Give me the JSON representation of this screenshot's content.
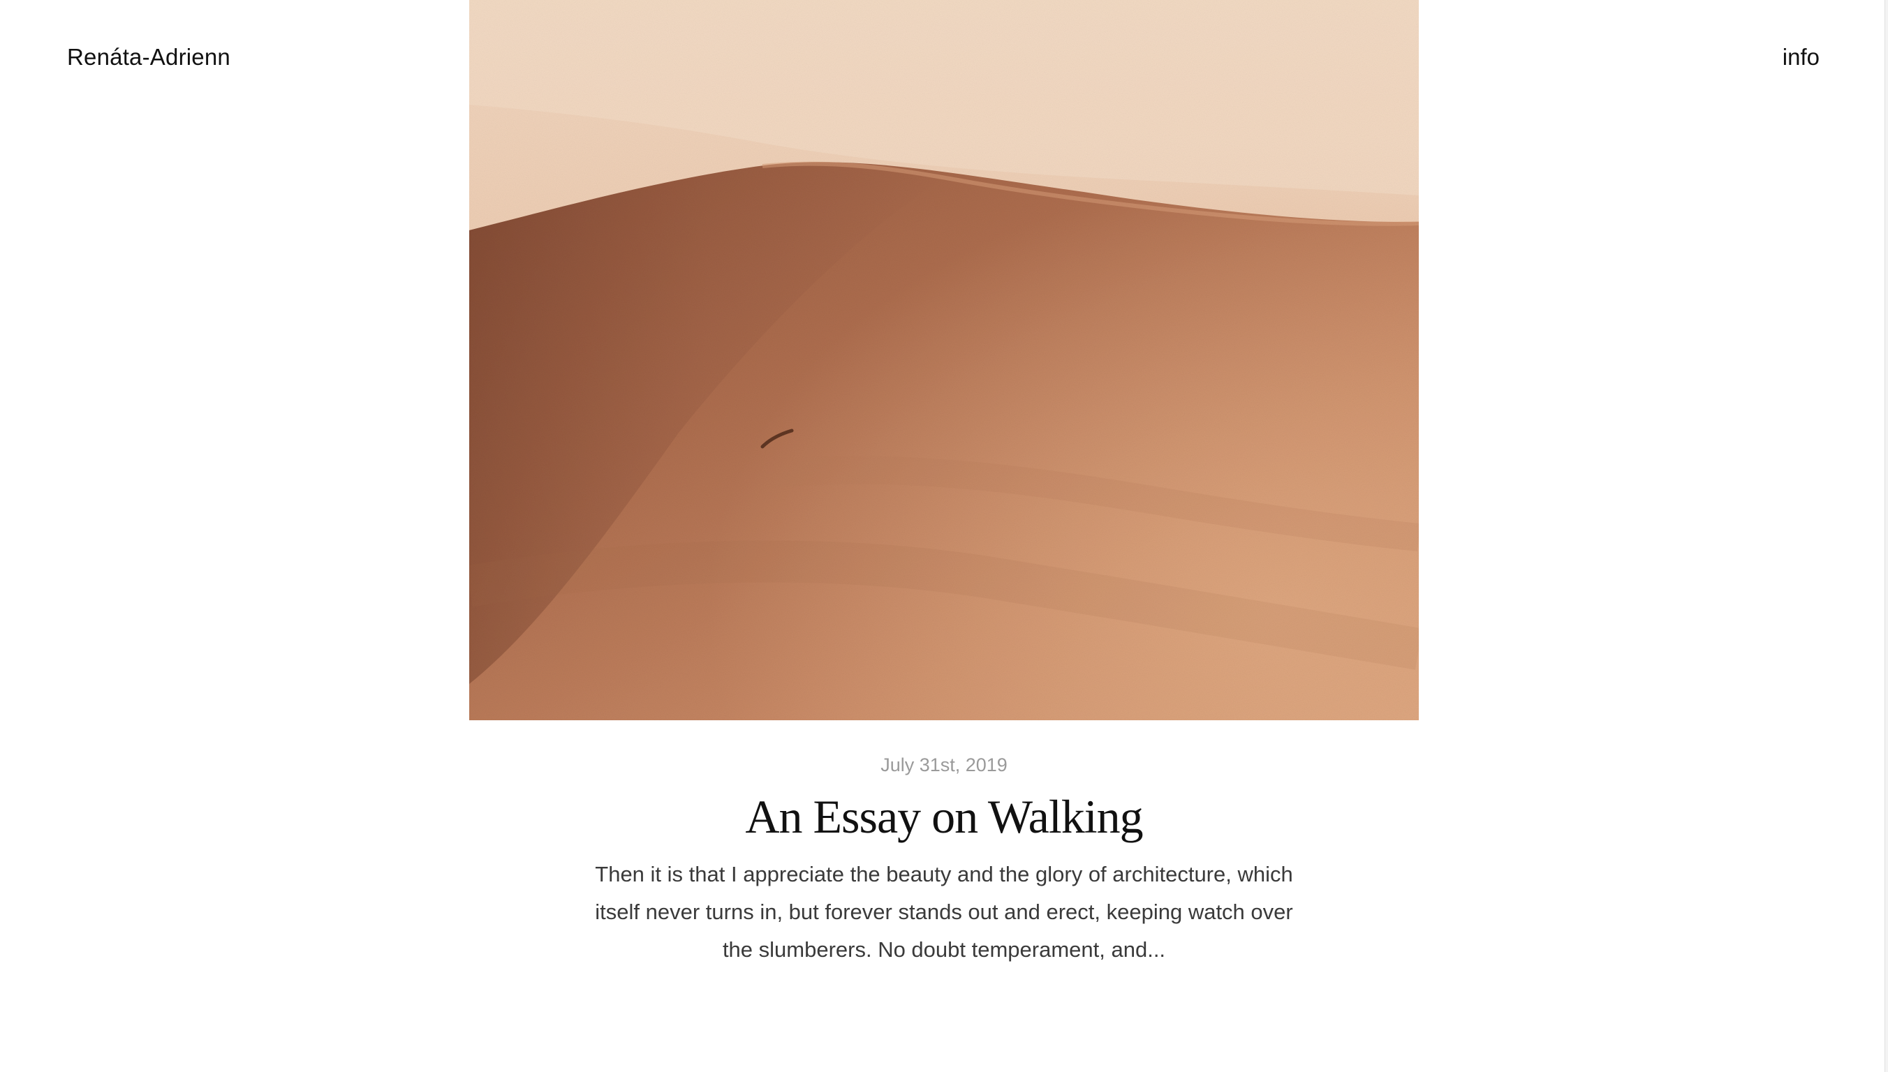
{
  "header": {
    "site_title": "Renáta-Adrienn",
    "nav_link": "info"
  },
  "post": {
    "image_alt": "sand dune",
    "date": "July 31st, 2019",
    "title": "An Essay on Walking",
    "excerpt": "Then it is that I appreciate the beauty and the glory of architecture, which itself never turns in, but forever stands out and erect, keeping watch over the slumberers. No doubt temperament, and..."
  },
  "colors": {
    "background": "#ffffff",
    "text": "#111111",
    "date": "#9a9a9a",
    "excerpt": "#3a3a3a",
    "sand_light": "#efd2b8",
    "sand_dark": "#a9694a"
  }
}
